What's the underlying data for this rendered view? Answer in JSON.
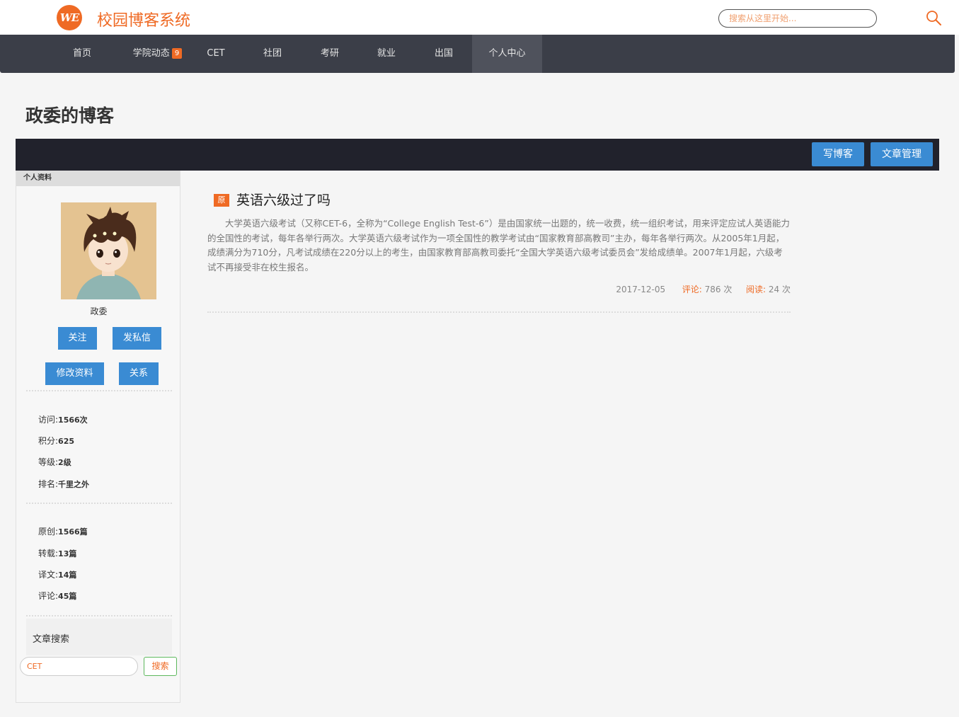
{
  "header": {
    "logo_text": "WE",
    "site_title": "校园博客系统",
    "search_placeholder": "搜索从这里开始..."
  },
  "nav": {
    "items": [
      {
        "label": "首页"
      },
      {
        "label": "学院动态",
        "badge": "9"
      },
      {
        "label": "CET"
      },
      {
        "label": "社团"
      },
      {
        "label": "考研"
      },
      {
        "label": "就业"
      },
      {
        "label": "出国"
      },
      {
        "label": "个人中心",
        "active": true
      }
    ]
  },
  "blog_title": "政委的博客",
  "toolbar": {
    "write_label": "写博客",
    "manage_label": "文章管理"
  },
  "sidebar": {
    "header": "个人资料",
    "username": "政委",
    "buttons": {
      "follow": "关注",
      "message": "发私信",
      "edit_profile": "修改资料",
      "relations": "关系"
    },
    "stats": [
      {
        "label": "访问:",
        "value": "1566次"
      },
      {
        "label": "积分:",
        "value": "625"
      },
      {
        "label": "等级:",
        "value": "2级"
      },
      {
        "label": "排名:",
        "value": "千里之外"
      }
    ],
    "counts": [
      {
        "label": "原创:",
        "value": "1566篇"
      },
      {
        "label": "转载:",
        "value": "13篇"
      },
      {
        "label": "译文:",
        "value": "14篇"
      },
      {
        "label": "评论:",
        "value": "45篇"
      }
    ],
    "search": {
      "label": "文章搜索",
      "value": "CET",
      "button": "搜索"
    }
  },
  "articles": [
    {
      "badge": "原",
      "title": "英语六级过了吗",
      "summary": "大学英语六级考试（又称CET-6，全称为“College English Test-6”）是由国家统一出题的，统一收费，统一组织考试，用来评定应试人英语能力的全国性的考试，每年各举行两次。大学英语六级考试作为一项全国性的教学考试由“国家教育部高教司”主办，每年各举行两次。从2005年1月起，成绩满分为710分，凡考试成绩在220分以上的考生，由国家教育部高教司委托“全国大学英语六级考试委员会”发给成绩单。2007年1月起，六级考试不再接受非在校生报名。",
      "date": "2017-12-05",
      "comments_label": "评论:",
      "comments": "786 次",
      "reads_label": "阅读:",
      "reads": "24 次"
    }
  ],
  "colors": {
    "accent": "#ef6a24",
    "nav_bg": "#3b3e48",
    "toolbar_bg": "#21222c",
    "button_blue": "#3a8bd3"
  }
}
